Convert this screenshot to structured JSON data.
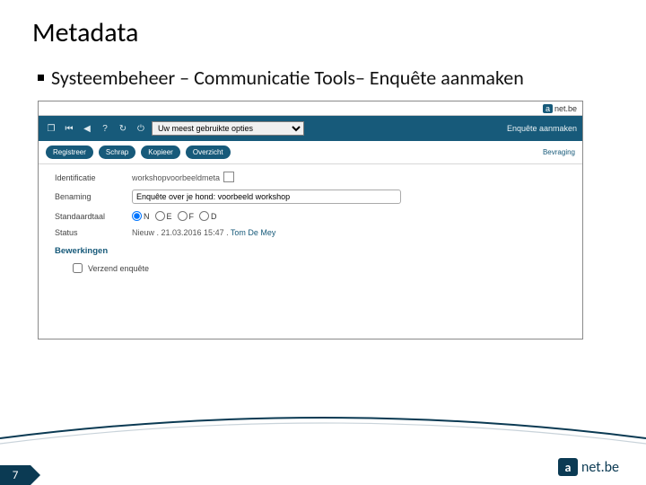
{
  "slide": {
    "title": "Metadata",
    "bullet": "Systeembeheer – Communicatie Tools– Enquête aanmaken",
    "page_number": "7",
    "footer_brand_a": "a",
    "footer_brand_text": "net.be"
  },
  "brand": {
    "a": "a",
    "text": "net.be"
  },
  "topbar": {
    "select_value": "Uw meest gebruikte opties",
    "page_title": "Enquête aanmaken"
  },
  "actions": {
    "registreer": "Registreer",
    "schrap": "Schrap",
    "kopieer": "Kopieer",
    "overzicht": "Overzicht",
    "bevraging": "Bevraging"
  },
  "form": {
    "identificatie_label": "Identificatie",
    "identificatie_value": "workshopvoorbeeldmeta",
    "benaming_label": "Benaming",
    "benaming_value": "Enquête over je hond: voorbeeld workshop",
    "standaardtaal_label": "Standaardtaal",
    "langs": {
      "n": "N",
      "e": "E",
      "f": "F",
      "d": "D"
    },
    "status_label": "Status",
    "status_value": "Nieuw . 21.03.2016 15:47 .",
    "status_user": "Tom De Mey",
    "bewerkingen_label": "Bewerkingen",
    "verzend_label": "Verzend enquête"
  }
}
